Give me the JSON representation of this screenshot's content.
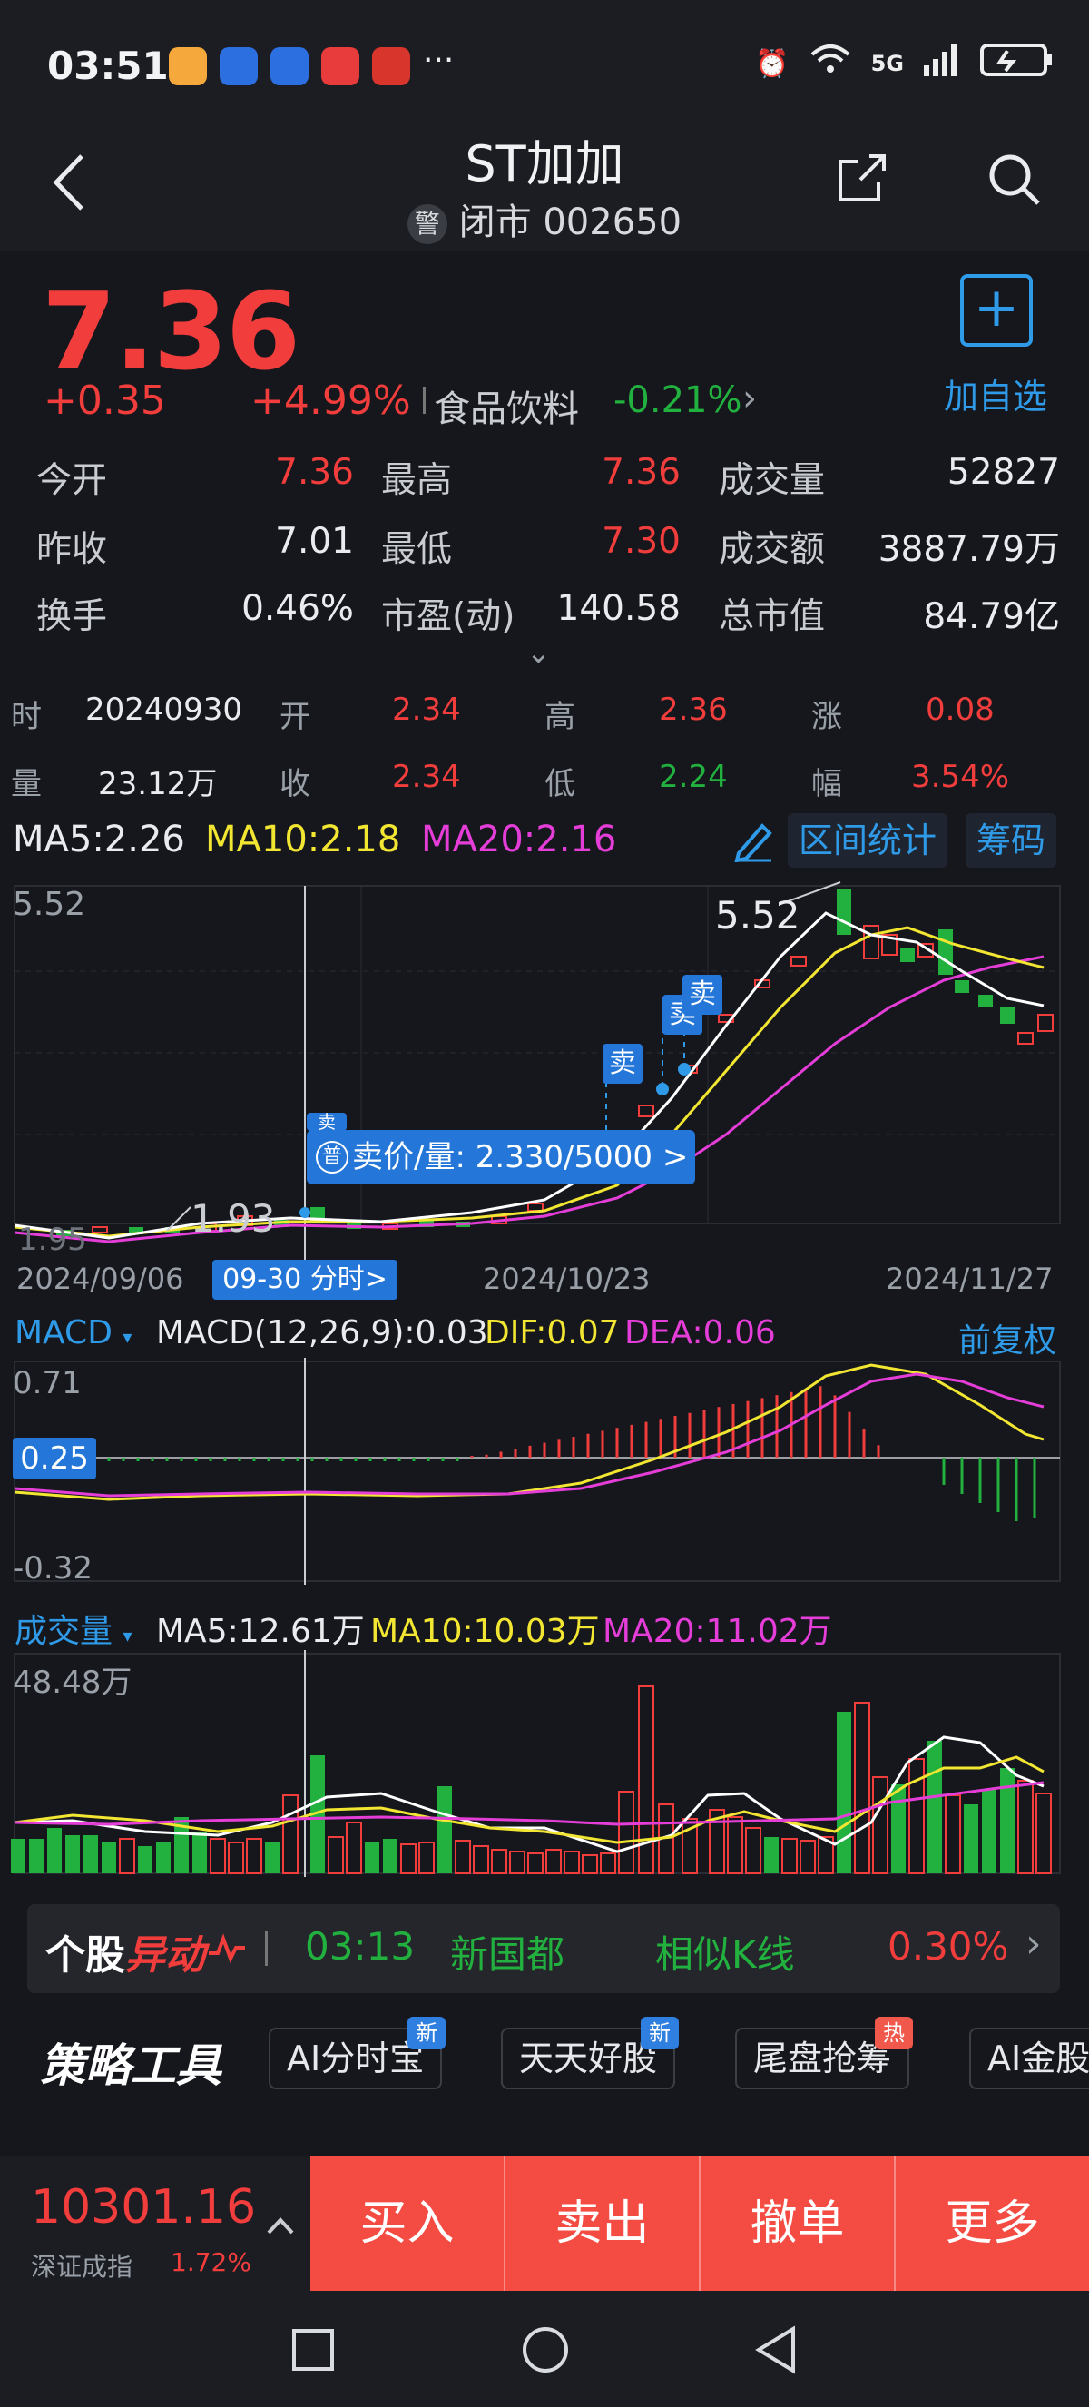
{
  "status": {
    "time": "03:51",
    "dots": "···",
    "network": "5G"
  },
  "nav": {
    "title": "ST加加",
    "badge": "警",
    "subtitle": "闭市 002650"
  },
  "quote": {
    "price": "7.36",
    "change": "+0.35",
    "change_pct": "+4.99%",
    "industry": "食品饮料",
    "industry_chg": "-0.21%",
    "add_label": "加自选",
    "stats": [
      {
        "label": "今开",
        "value": "7.36",
        "color": "#f23d3d"
      },
      {
        "label": "最高",
        "value": "7.36",
        "color": "#f23d3d"
      },
      {
        "label": "成交量",
        "value": "52827",
        "color": "#e9ebee"
      },
      {
        "label": "昨收",
        "value": "7.01",
        "color": "#e9ebee"
      },
      {
        "label": "最低",
        "value": "7.30",
        "color": "#f23d3d"
      },
      {
        "label": "成交额",
        "value": "3887.79万",
        "color": "#e9ebee"
      },
      {
        "label": "换手",
        "value": "0.46%",
        "color": "#e9ebee"
      },
      {
        "label": "市盈(动)",
        "value": "140.58",
        "color": "#e9ebee"
      },
      {
        "label": "总市值",
        "value": "84.79亿",
        "color": "#e9ebee"
      }
    ]
  },
  "info": {
    "time_label": "时",
    "date": "20240930",
    "open_label": "开",
    "open": "2.34",
    "high_label": "高",
    "high": "2.36",
    "rise_label": "涨",
    "rise": "0.08",
    "vol_label": "量",
    "vol": "23.12万",
    "close_label": "收",
    "close": "2.34",
    "low_label": "低",
    "low": "2.24",
    "amp_label": "幅",
    "amp": "3.54%"
  },
  "ma": {
    "ma5": "MA5:2.26",
    "ma10": "MA10:2.18",
    "ma20": "MA20:2.16",
    "range_stat": "区间统计",
    "chips": "筹码"
  },
  "kline": {
    "top_label": "5.52",
    "bottom_label": "1.95",
    "max_label": "5.52",
    "min_label": "1.93",
    "dates": [
      "2024/09/06",
      "2024/10/23",
      "2024/11/27"
    ],
    "date_tag": "09-30 分时>",
    "tooltip_badge": "普",
    "tooltip": "卖价/量: 2.330/5000 >",
    "sell_label": "卖",
    "sell_label_partial": "卖"
  },
  "macd": {
    "name": "MACD",
    "params": "MACD(12,26,9):0.03",
    "dif": "DIF:0.07",
    "dea": "DEA:0.06",
    "fq": "前复权",
    "top": "0.71",
    "cur": "0.25",
    "bottom": "-0.32"
  },
  "volume": {
    "name": "成交量",
    "ma5": "MA5:12.61万",
    "ma10": "MA10:10.03万",
    "ma20": "MA20:11.02万",
    "top": "48.48万"
  },
  "banner": {
    "brand1": "个股",
    "brand2": "异动",
    "time": "03:13",
    "name": "新国都",
    "kline": "相似K线",
    "pct": "0.30%"
  },
  "tools": {
    "brand": "策略工具",
    "items": [
      {
        "label": "AI分时宝",
        "badge": "新",
        "badge_color": "#2f7fe0"
      },
      {
        "label": "天天好股",
        "badge": "新",
        "badge_color": "#2f7fe0"
      },
      {
        "label": "尾盘抢筹",
        "badge": "热",
        "badge_color": "#f0584c"
      },
      {
        "label": "AI金股",
        "badge": "",
        "badge_color": ""
      }
    ]
  },
  "trade": {
    "index_value": "10301.16",
    "index_name": "深证成指",
    "index_pct": "1.72%",
    "buttons": [
      "买入",
      "卖出",
      "撤单",
      "更多"
    ]
  },
  "colors": {
    "up": "#f23d3d",
    "down": "#22b13f",
    "accent": "#2f9be8",
    "trade_bar": "#f44b43"
  }
}
